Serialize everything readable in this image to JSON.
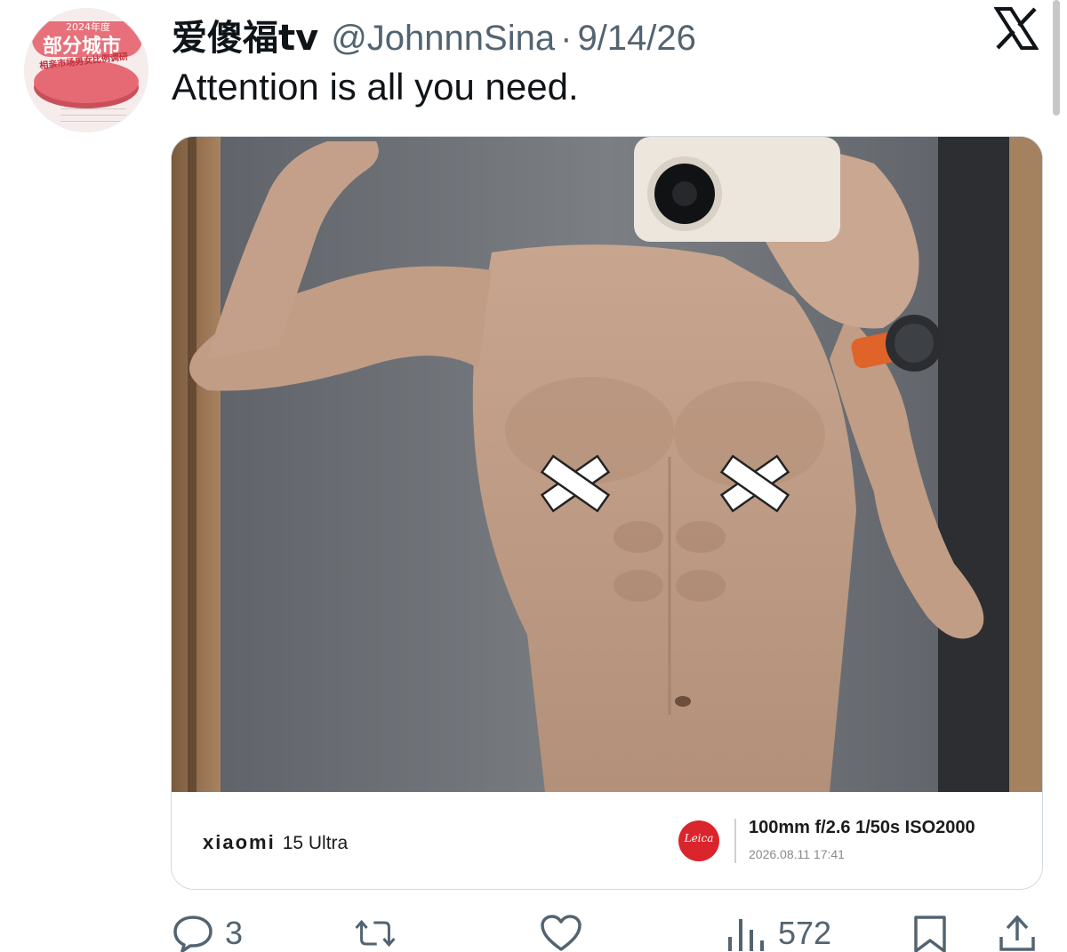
{
  "user": {
    "display_name": "爱傻福tv",
    "handle": "@JohnnnSina",
    "separator": "·",
    "date": "9/14/26",
    "avatar": {
      "year_text": "2024年度",
      "city_text": "部分城市",
      "sub_text": "相亲市场男女比例调研"
    }
  },
  "tweet": {
    "text": "Attention is all you need."
  },
  "platform_logo": "x-logo",
  "media": {
    "camera_brand": "xiaomi",
    "camera_model": "15 Ultra",
    "lens_logo": "Leica",
    "specs": "100mm  f/2.6  1/50s  ISO2000",
    "timestamp": "2026.08.11 17:41"
  },
  "actions": {
    "reply_count": "3",
    "repost_count": "",
    "like_count": "",
    "views_count": "572"
  },
  "colors": {
    "text_primary": "#0f1419",
    "text_secondary": "#536471",
    "border": "#cfd9de",
    "leica_red": "#d9252b"
  }
}
